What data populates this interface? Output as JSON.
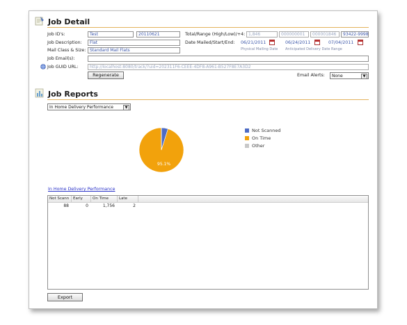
{
  "job_detail": {
    "title": "Job Detail",
    "labels": {
      "job_ids": "Job ID's:",
      "job_description": "Job Description:",
      "mail_class": "Mail Class & Size:",
      "job_emails": "Job Email(s):",
      "job_guid_url": "Job GUID URL:",
      "total_range": "Total/Range (High/Low)/+4:",
      "date_mailed": "Date Mailed/Start/End:",
      "email_alerts": "Email Alerts:"
    },
    "fields": {
      "job_id_1": "Test",
      "job_id_2": "20110621",
      "description": "Flat",
      "mail_class": "Standard Mail Flats",
      "emails": "",
      "guid_url": "http://localhost:8080/track/?uid=202311F6-CEEE-4DF8-A961-B527F8E7A3D2",
      "total": "1,846",
      "range_high": "000000001",
      "range_low": "000001846",
      "plus4": "93422-9998"
    },
    "dates": {
      "mailed": "06/21/2011",
      "start": "06/24/2011",
      "end": "07/04/2011",
      "physical_caption": "Physical Mailing Date",
      "anticipated_caption": "Anticipated Delivery Date Range"
    },
    "regenerate_label": "Regenerate",
    "email_alerts_value": "None"
  },
  "job_reports": {
    "title": "Job Reports",
    "report_select": "In Home Delivery Performance",
    "report_link": "In Home Delivery Performance",
    "table_headers": [
      "Not Scann",
      "Early",
      "On Time",
      "Late"
    ],
    "table_rows": [
      [
        "88",
        "0",
        "1,756",
        "2"
      ]
    ],
    "export_label": "Export"
  },
  "chart_data": {
    "type": "pie",
    "slices": [
      {
        "label": "Not Scanned",
        "value": 4.8,
        "color": "#4d6bc4"
      },
      {
        "label": "On Time",
        "value": 95.1,
        "color": "#f2a20c"
      },
      {
        "label": "Other",
        "value": 0.1,
        "color": "#c8c8c8"
      }
    ],
    "data_labels": [
      "95.1%"
    ],
    "legend": [
      "Not Scanned",
      "On Time",
      "Other"
    ],
    "legend_position": "right"
  }
}
